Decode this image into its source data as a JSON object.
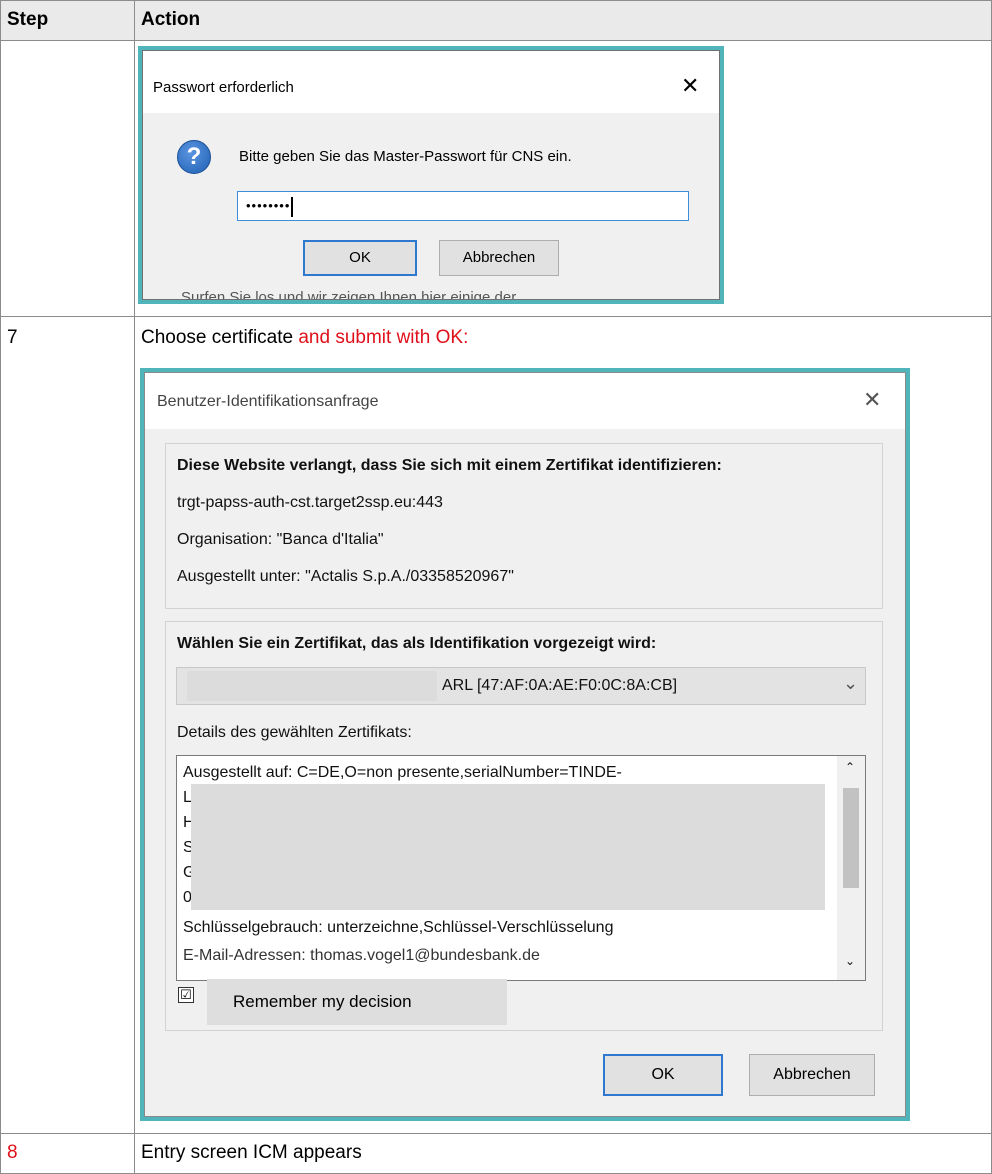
{
  "table": {
    "headers": {
      "step": "Step",
      "action": "Action"
    },
    "rows": [
      {
        "step": "",
        "action": ""
      },
      {
        "step": "7",
        "action_prefix": "Choose certificate ",
        "action_highlight": "and submit with OK:"
      },
      {
        "step": "8",
        "action": "Entry screen ICM appears"
      }
    ]
  },
  "dialog1": {
    "title": "Passwort erforderlich",
    "close": "✕",
    "message": "Bitte geben Sie das Master-Passwort für CNS ein.",
    "password_value": "••••••••",
    "ok": "OK",
    "cancel": "Abbrechen",
    "background_text": "Surfen Sie los und wir zeigen Ihnen hier einige der"
  },
  "dialog2": {
    "title": "Benutzer-Identifikationsanfrage",
    "close": "✕",
    "request_heading": "Diese Website verlangt, dass Sie sich mit einem Zertifikat identifizieren:",
    "host": "trgt-papss-auth-cst.target2ssp.eu:443",
    "organisation": "Organisation: \"Banca d'Italia\"",
    "issued_under": "Ausgestellt unter: \"Actalis S.p.A./03358520967\"",
    "choose_heading": "Wählen Sie ein Zertifikat, das als Identifikation vorgezeigt wird:",
    "selected_cert": "ARL [47:AF:0A:AE:F0:0C:8A:CB]",
    "details_label": "Details des gewählten Zertifikats:",
    "details_lines": [
      "Ausgestellt auf: C=DE,O=non presente,serialNumber=TINDE-",
      "L",
      "H",
      "S",
      "G",
      "0",
      "Schlüsselgebrauch: unterzeichne,Schlüssel-Verschlüsselung",
      "E-Mail-Adressen: thomas.vogel1@bundesbank.de"
    ],
    "remember_checked": "☑",
    "remember_label": "Remember my decision",
    "ok": "OK",
    "cancel": "Abbrechen"
  },
  "colors": {
    "highlight_red": "#e0101a",
    "dialog_frame": "#4fb5bb",
    "default_button_border": "#2f78d0"
  }
}
